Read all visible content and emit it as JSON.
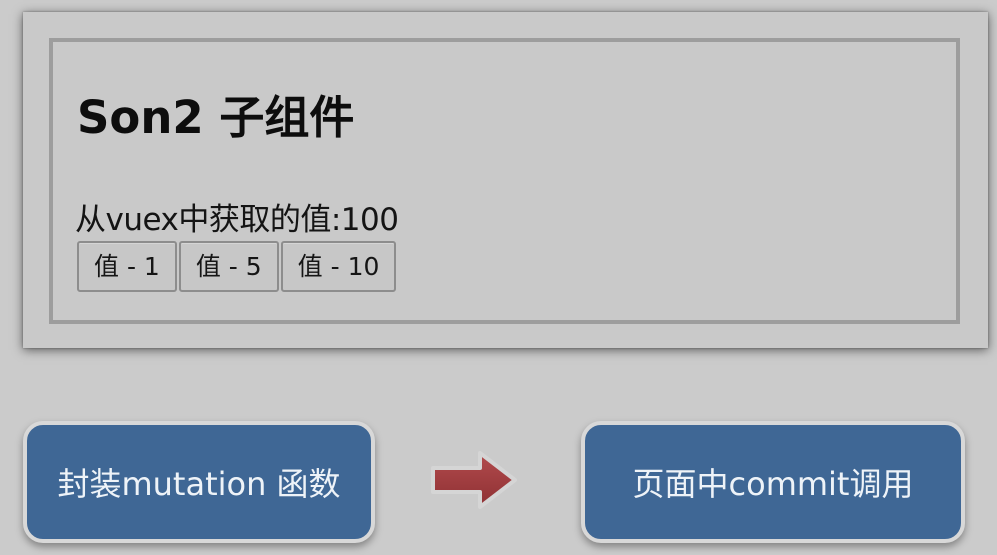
{
  "component": {
    "title": "Son2 子组件",
    "value_label": "从vuex中获取的值:100",
    "buttons": [
      "值 - 1",
      "值 - 5",
      "值 - 10"
    ]
  },
  "flow": {
    "left_box": "封装mutation 函数",
    "right_box": "页面中commit调用",
    "arrow_icon": "right-arrow-icon"
  },
  "colors": {
    "background": "#cbcbcb",
    "box_blue": "#3f6795",
    "arrow_red": "#9b3a3c"
  }
}
